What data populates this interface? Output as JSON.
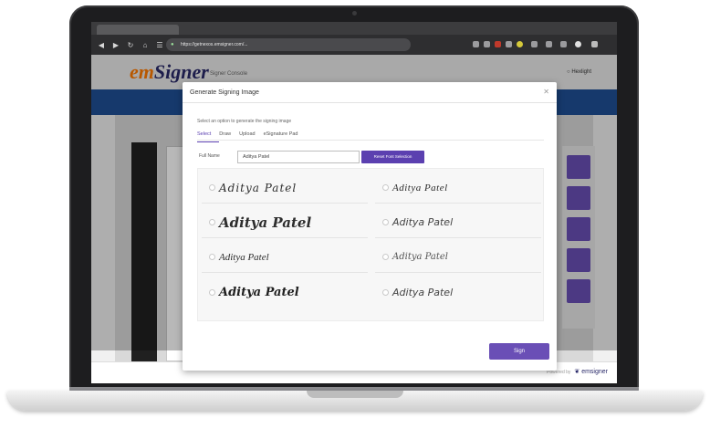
{
  "browser": {
    "url": "https://getnexos.emsigner.com/...",
    "nav_icons": [
      "back-icon",
      "forward-icon",
      "refresh-icon",
      "home-icon",
      "reader-icon"
    ]
  },
  "app": {
    "logo_em": "em",
    "logo_signer": "Signer",
    "subtitle": "Signer Console",
    "user_link": "○  Hexlight"
  },
  "footer": {
    "muted": "Powered by",
    "brand": "❦ emsigner"
  },
  "modal": {
    "title": "Generate Signing Image",
    "close_icon": "close-icon",
    "hint": "Select an option to generate the signing image",
    "tabs": [
      "Select",
      "Draw",
      "Upload",
      "eSignature Pad"
    ],
    "active_tab": 0,
    "full_name_label": "Full Name",
    "full_name_value": "Aditya Patel",
    "reset_label": "Reset Font Selection",
    "signatures_left": [
      "Aditya Patel",
      "Aditya Patel",
      "Aditya Patel",
      "Aditya Patel"
    ],
    "signatures_right": [
      "Aditya Patel",
      "Aditya Patel",
      "Aditya Patel",
      "Aditya Patel"
    ],
    "sign_label": "Sign"
  },
  "colors": {
    "accent": "#5b40b0",
    "brand_orange": "#ff7a00",
    "band_blue": "#1f4f96"
  }
}
